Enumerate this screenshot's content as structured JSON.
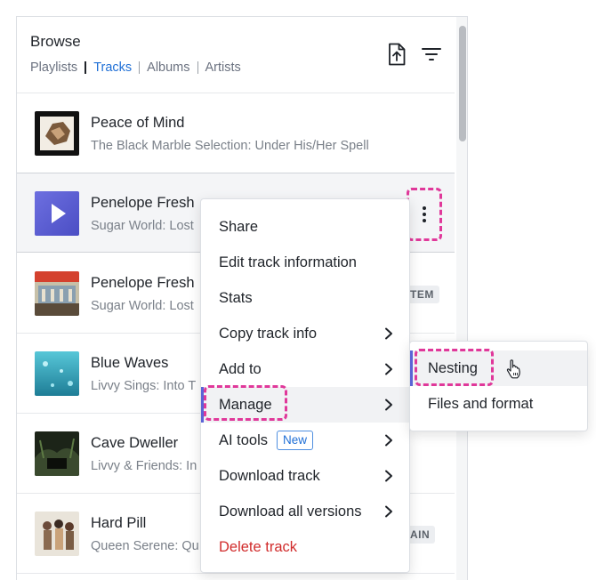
{
  "header": {
    "title": "Browse",
    "filters": [
      "Playlists",
      "Tracks",
      "Albums",
      "Artists"
    ],
    "active_filter": "Tracks",
    "upload_icon": "upload-file-icon",
    "filter_icon": "filter-icon"
  },
  "tracks": [
    {
      "name": "Peace of Mind",
      "subtitle": "The Black Marble Selection: Under His/Her Spell",
      "badge": ""
    },
    {
      "name": "Penelope Fresh",
      "subtitle": "Sugar World: Lost",
      "badge": ""
    },
    {
      "name": "Penelope Fresh",
      "subtitle": "Sugar World: Lost",
      "badge": "TEM"
    },
    {
      "name": "Blue Waves",
      "subtitle": "Livvy Sings: Into T",
      "badge": ""
    },
    {
      "name": "Cave Dweller",
      "subtitle": "Livvy & Friends: In",
      "badge": ""
    },
    {
      "name": "Hard Pill",
      "subtitle": "Queen Serene: Qu",
      "badge": "AIN"
    }
  ],
  "menu": {
    "items": [
      {
        "label": "Share",
        "submenu": false
      },
      {
        "label": "Edit track information",
        "submenu": false
      },
      {
        "label": "Stats",
        "submenu": false
      },
      {
        "label": "Copy track info",
        "submenu": true
      },
      {
        "label": "Add to",
        "submenu": true
      },
      {
        "label": "Manage",
        "submenu": true
      },
      {
        "label": "AI tools",
        "submenu": true,
        "badge": "New"
      },
      {
        "label": "Download track",
        "submenu": true
      },
      {
        "label": "Download all versions",
        "submenu": true
      },
      {
        "label": "Delete track",
        "submenu": false
      }
    ],
    "hovered": "Manage"
  },
  "submenu": {
    "items": [
      "Nesting",
      "Files and format"
    ],
    "hovered": "Nesting"
  },
  "colors": {
    "accent": "#1f6fd6",
    "highlight_dash": "#e0389a",
    "hover_bar": "#5b63d6",
    "danger": "#d12c2c"
  }
}
